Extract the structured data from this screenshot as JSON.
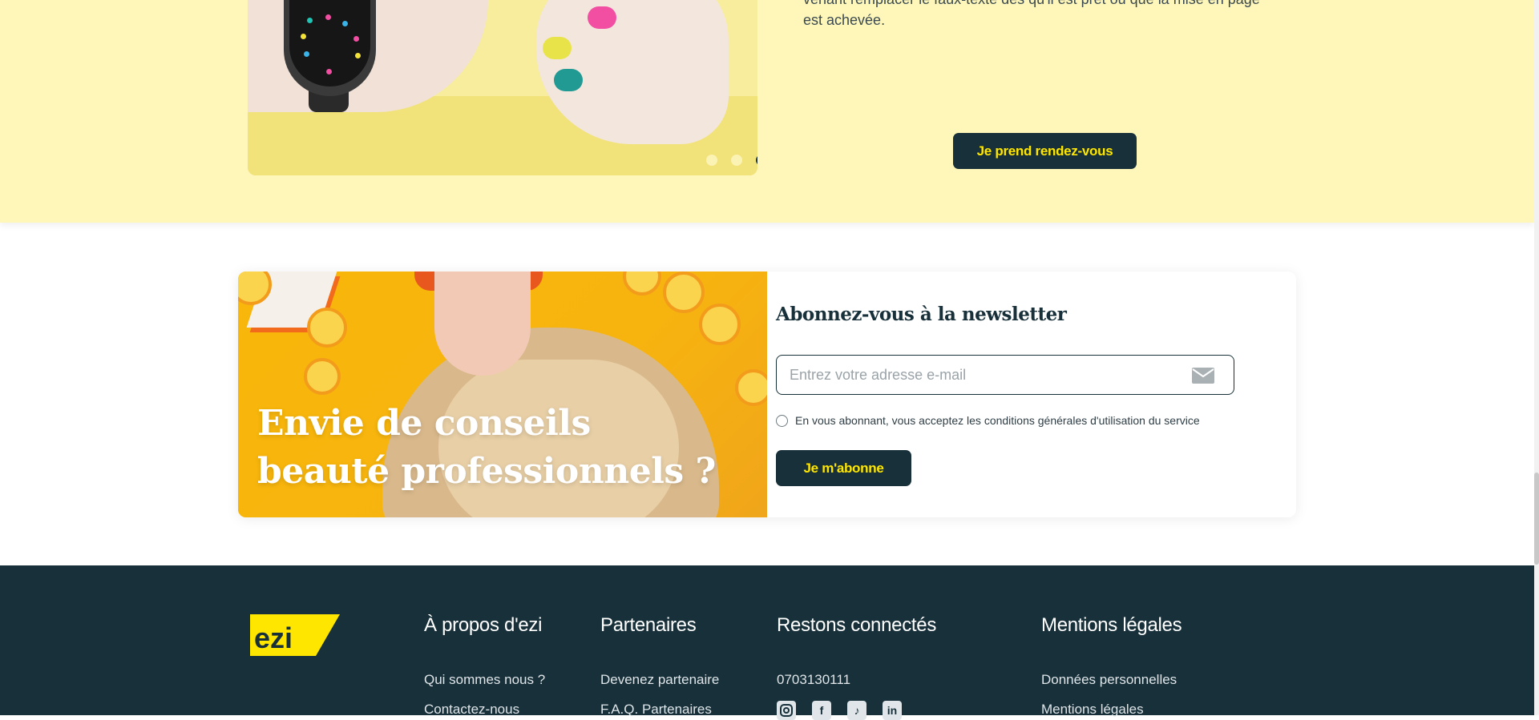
{
  "hero": {
    "text_line1": "venant remplacer le faux-texte dès qu'il est prêt ou que la mise en page",
    "text_line2": "est achevée.",
    "cta_label": "Je prend rendez-vous",
    "carousel": {
      "total_slides": 4,
      "active_index": 2
    }
  },
  "newsletter": {
    "image_title_line1": "Envie de conseils",
    "image_title_line2": "beauté professionnels ?",
    "heading": "Abonnez-vous à la newsletter",
    "email_placeholder": "Entrez votre adresse e-mail",
    "email_value": "",
    "email_icon": "mail-icon",
    "consent_text": "En vous abonnant, vous acceptez les conditions générales d'utilisation du service",
    "submit_label": "Je m'abonne"
  },
  "footer": {
    "logo_text": "ezi",
    "columns": [
      {
        "title": "À propos d'ezi",
        "links": [
          "Qui sommes nous ?",
          "Contactez-nous"
        ]
      },
      {
        "title": "Partenaires",
        "links": [
          "Devenez partenaire",
          "F.A.Q. Partenaires"
        ]
      },
      {
        "title": "Restons connectés",
        "phone": "0703130111",
        "socials": [
          "instagram-icon",
          "facebook-icon",
          "tiktok-icon",
          "linkedin-icon"
        ]
      },
      {
        "title": "Mentions légales",
        "links": [
          "Données personnelles",
          "Mentions légales"
        ]
      }
    ]
  },
  "colors": {
    "hero_bg": "#fef7b9",
    "dark": "#17303a",
    "accent_yellow": "#ffe600"
  }
}
